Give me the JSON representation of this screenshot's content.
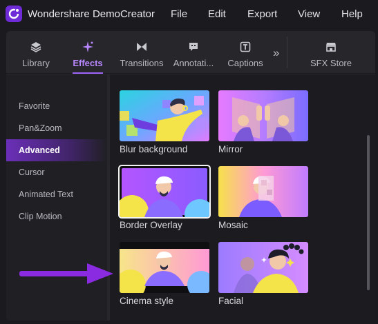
{
  "app": {
    "title": "Wondershare DemoCreator"
  },
  "menu": [
    "File",
    "Edit",
    "Export",
    "View",
    "Help"
  ],
  "tabs": [
    {
      "label": "Library",
      "icon": "layers-icon"
    },
    {
      "label": "Effects",
      "icon": "sparkle-icon",
      "active": true
    },
    {
      "label": "Transitions",
      "icon": "transition-icon"
    },
    {
      "label": "Annotati...",
      "icon": "annotation-icon"
    },
    {
      "label": "Captions",
      "icon": "captions-icon"
    },
    {
      "label": "SFX Store",
      "icon": "store-icon"
    }
  ],
  "sidebar": {
    "items": [
      "Favorite",
      "Pan&Zoom",
      "Advanced",
      "Cursor",
      "Animated Text",
      "Clip Motion"
    ],
    "active": "Advanced"
  },
  "effects": [
    {
      "label": "Blur background"
    },
    {
      "label": "Mirror"
    },
    {
      "label": "Border Overlay",
      "selected": true
    },
    {
      "label": "Mosaic"
    },
    {
      "label": "Cinema style"
    },
    {
      "label": "Facial"
    }
  ],
  "colors": {
    "accent": "#a064ff",
    "arrow": "#8a2be2",
    "active_bg": "#6b2fb8"
  }
}
